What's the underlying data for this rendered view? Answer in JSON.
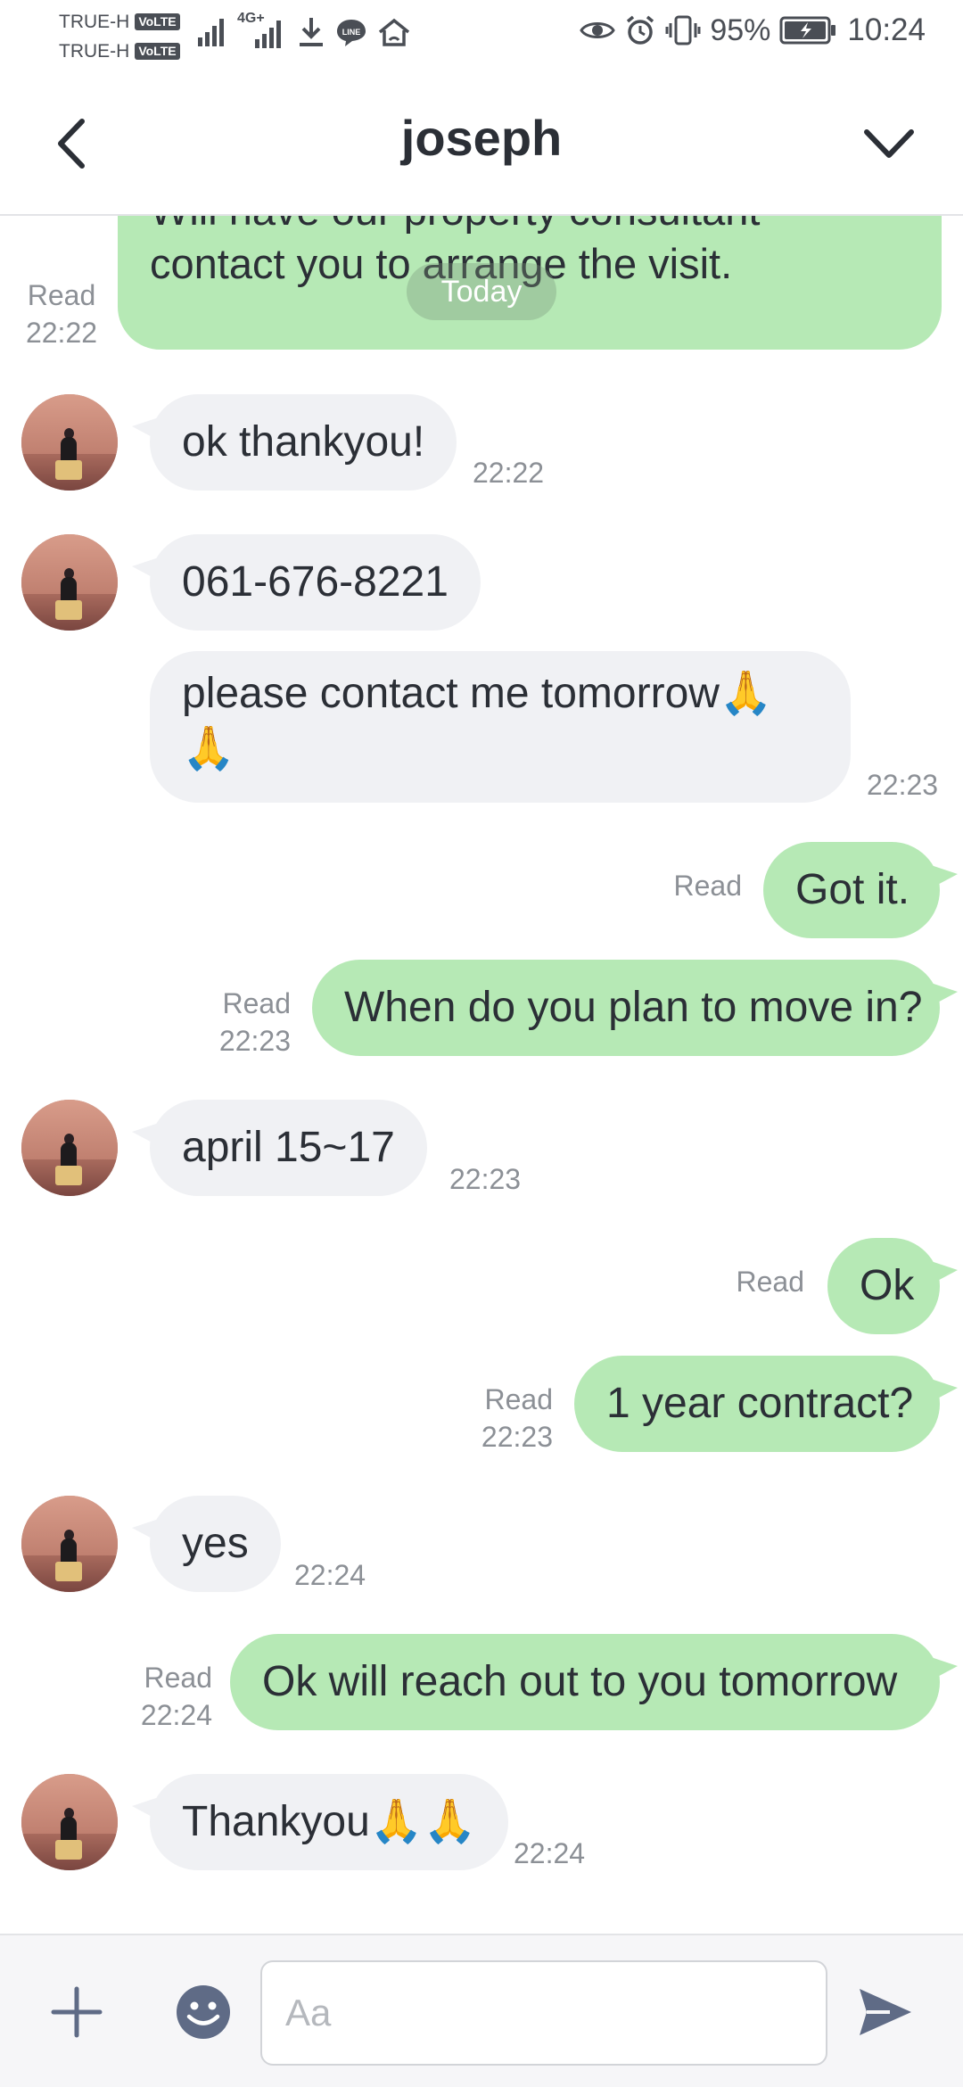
{
  "status_bar": {
    "carrier1": "TRUE-H",
    "carrier2": "TRUE-H",
    "volte_badge": "VoLTE",
    "network_label": "4G+",
    "battery_percent": "95%",
    "time": "10:24",
    "left_icons": [
      "signal-bars-icon",
      "signal-4g-icon",
      "download-icon",
      "line-app-icon",
      "home-wifi-icon"
    ],
    "right_icons": [
      "eye-icon",
      "alarm-icon",
      "vibrate-icon",
      "battery-charging-icon"
    ]
  },
  "header": {
    "title": "joseph",
    "back_icon": "back-arrow-icon",
    "menu_icon": "chevron-down-icon"
  },
  "chat": {
    "date_separator": "Today",
    "messages": [
      {
        "id": 0,
        "direction": "out",
        "lines": [
          "Will have our property consultant",
          "contact you to arrange the visit."
        ],
        "status": "Read",
        "time": "22:22"
      },
      {
        "id": 1,
        "direction": "in",
        "text": "ok thankyou!",
        "time": "22:22"
      },
      {
        "id": 2,
        "direction": "in",
        "text": "061-676-8221",
        "time": ""
      },
      {
        "id": 3,
        "direction": "in",
        "lines": [
          "please contact me tomorrow🙏",
          "🙏"
        ],
        "time": "22:23"
      },
      {
        "id": 4,
        "direction": "out",
        "text": "Got it.",
        "status": "Read",
        "time": ""
      },
      {
        "id": 5,
        "direction": "out",
        "text": "When do you plan to move in?",
        "status": "Read",
        "time": "22:23"
      },
      {
        "id": 6,
        "direction": "in",
        "text": "april 15~17",
        "time": "22:23"
      },
      {
        "id": 7,
        "direction": "out",
        "text": "Ok",
        "status": "Read",
        "time": ""
      },
      {
        "id": 8,
        "direction": "out",
        "text": "1 year contract?",
        "status": "Read",
        "time": "22:23"
      },
      {
        "id": 9,
        "direction": "in",
        "text": "yes",
        "time": "22:24"
      },
      {
        "id": 10,
        "direction": "out",
        "text": "Ok will reach out to you tomorrow",
        "status": "Read",
        "time": "22:24"
      },
      {
        "id": 11,
        "direction": "in",
        "text": "Thankyou🙏🙏",
        "time": "22:24"
      }
    ]
  },
  "input_bar": {
    "placeholder": "Aa",
    "value": "",
    "icons": [
      "plus-icon",
      "smiley-icon",
      "send-icon"
    ]
  },
  "colors": {
    "outgoing_bubble": "#b6e9b5",
    "incoming_bubble": "#f0f1f4",
    "meta_text": "#8c9096",
    "icon_slate": "#5f6b86"
  }
}
